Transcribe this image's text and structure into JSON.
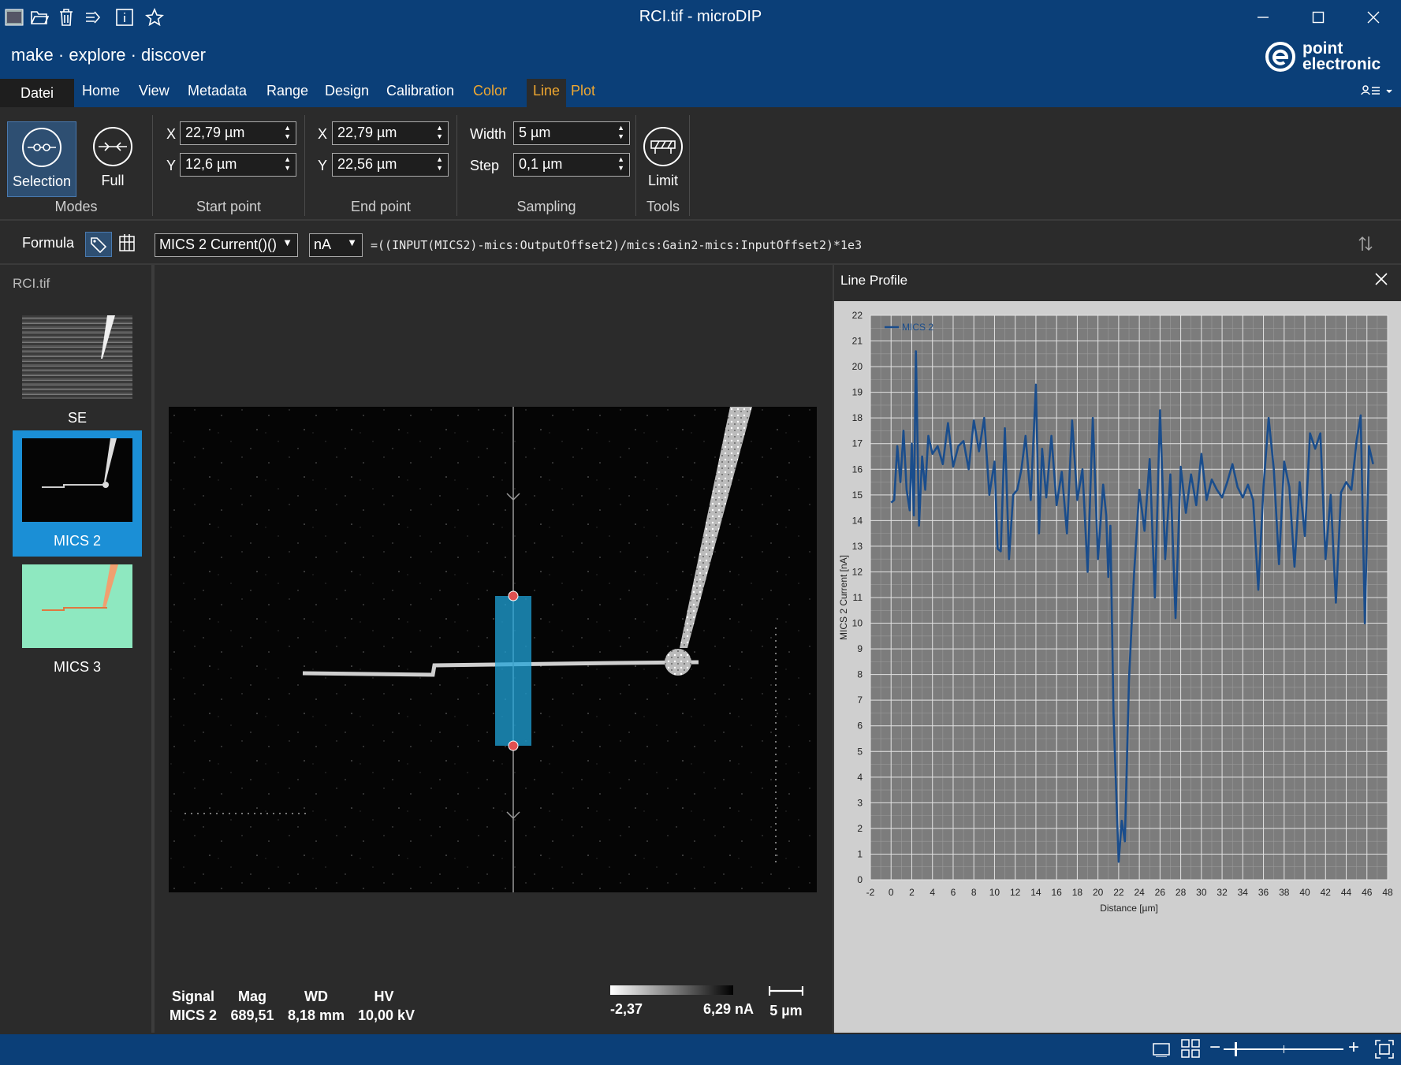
{
  "window": {
    "title": "RCI.tif - microDIP"
  },
  "header": {
    "slogan": "make · explore · discover",
    "brand": {
      "line1": "point",
      "line2": "electronic"
    }
  },
  "menu": {
    "file": "Datei",
    "items": [
      "Home",
      "View",
      "Metadata",
      "Range",
      "Design",
      "Calibration",
      "Color",
      "Line",
      "Plot"
    ]
  },
  "colors": {
    "accent": "#0b3f78",
    "contextual_tab": "#f0a830",
    "plot_line": "#1a4d8c",
    "selection": "#1fa3d8",
    "handle": "#e05050"
  },
  "ribbon": {
    "modes": {
      "selection": "Selection",
      "full": "Full",
      "label": "Modes"
    },
    "start": {
      "x_label": "X",
      "x": "22,79 µm",
      "y_label": "Y",
      "y": "12,6 µm",
      "label": "Start point"
    },
    "end": {
      "x_label": "X",
      "x": "22,79 µm",
      "y_label": "Y",
      "y": "22,56 µm",
      "label": "End point"
    },
    "sampling": {
      "width_label": "Width",
      "width": "5 µm",
      "step_label": "Step",
      "step": "0,1 µm",
      "label": "Sampling"
    },
    "tools": {
      "limit": "Limit",
      "label": "Tools"
    }
  },
  "formula": {
    "label": "Formula",
    "signal": "MICS 2 Current()()",
    "unit": "nA",
    "expression": "=((INPUT(MICS2)-mics:OutputOffset2)/mics:Gain2-mics:InputOffset2)*1e3"
  },
  "files": {
    "name": "RCI.tif",
    "thumbs": [
      "SE",
      "MICS 2",
      "MICS 3"
    ],
    "selected": "MICS 2"
  },
  "scaninfo": {
    "signal_h": "Signal",
    "signal": "MICS 2",
    "mag_h": "Mag",
    "mag": "689,51",
    "wd_h": "WD",
    "wd": "8,18 mm",
    "hv_h": "HV",
    "hv": "10,00 kV",
    "scale_min": "-2,37",
    "scale_max": "6,29 nA",
    "scalebar": "5 µm"
  },
  "panel": {
    "title": "Line Profile"
  },
  "chart_data": {
    "type": "line",
    "xlabel": "Distance [µm]",
    "ylabel": "MICS 2 Current [nA]",
    "xlim": [
      -2,
      48
    ],
    "ylim": [
      0,
      22
    ],
    "xticks": [
      -2,
      0,
      2,
      4,
      6,
      8,
      10,
      12,
      14,
      16,
      18,
      20,
      22,
      24,
      26,
      28,
      30,
      32,
      34,
      36,
      38,
      40,
      42,
      44,
      46,
      48
    ],
    "yticks": [
      0,
      1,
      2,
      3,
      4,
      5,
      6,
      7,
      8,
      9,
      10,
      11,
      12,
      13,
      14,
      15,
      16,
      17,
      18,
      19,
      20,
      21,
      22
    ],
    "grid": true,
    "legend": "top-left",
    "series": [
      {
        "name": "MICS 2",
        "x": [
          0,
          0.3,
          0.6,
          0.9,
          1.2,
          1.5,
          1.8,
          2.0,
          2.2,
          2.4,
          2.7,
          3.0,
          3.3,
          3.6,
          4.0,
          4.5,
          5.0,
          5.5,
          6.0,
          6.5,
          7.0,
          7.5,
          8.0,
          8.5,
          9.0,
          9.5,
          10.0,
          10.3,
          10.6,
          11.0,
          11.4,
          11.8,
          12.2,
          12.6,
          13.0,
          13.5,
          14.0,
          14.3,
          14.6,
          15.0,
          15.5,
          16.0,
          16.5,
          17.0,
          17.5,
          18.0,
          18.5,
          19.0,
          19.5,
          20.0,
          20.5,
          20.8,
          21.0,
          21.2,
          21.5,
          21.8,
          22.0,
          22.3,
          22.6,
          23.0,
          23.5,
          24.0,
          24.5,
          25.0,
          25.5,
          26.0,
          26.5,
          27.0,
          27.5,
          28.0,
          28.5,
          29.0,
          29.5,
          30.0,
          30.5,
          31.0,
          31.5,
          32.0,
          32.5,
          33.0,
          33.5,
          34.0,
          34.5,
          35.0,
          35.5,
          36.0,
          36.5,
          37.0,
          37.5,
          38.0,
          38.5,
          39.0,
          39.5,
          40.0,
          40.5,
          41.0,
          41.5,
          42.0,
          42.5,
          43.0,
          43.5,
          44.0,
          44.5,
          45.0,
          45.4,
          45.8,
          46.2,
          46.6
        ],
        "values": [
          14.7,
          14.8,
          16.9,
          15.5,
          17.5,
          15.2,
          14.4,
          17.0,
          14.2,
          20.6,
          13.8,
          16.5,
          15.2,
          17.3,
          16.6,
          16.9,
          16.2,
          17.8,
          16.1,
          16.9,
          17.1,
          16.0,
          17.9,
          16.7,
          18.0,
          15.0,
          16.3,
          12.9,
          12.8,
          17.6,
          12.5,
          15.0,
          15.2,
          16.0,
          17.3,
          14.8,
          19.3,
          13.5,
          16.8,
          14.9,
          17.3,
          14.6,
          15.9,
          13.5,
          17.9,
          14.8,
          16.0,
          12.0,
          18.0,
          12.5,
          15.4,
          14.2,
          11.8,
          13.8,
          6.5,
          3.0,
          0.7,
          2.3,
          1.5,
          7.8,
          12.0,
          15.2,
          13.6,
          16.4,
          11.0,
          18.3,
          12.5,
          15.8,
          10.2,
          16.1,
          14.3,
          15.8,
          14.6,
          16.6,
          14.8,
          15.6,
          15.2,
          14.9,
          15.5,
          16.2,
          15.3,
          14.9,
          15.4,
          14.8,
          11.3,
          15.3,
          18.0,
          16.0,
          12.3,
          16.3,
          15.3,
          12.2,
          15.5,
          13.4,
          17.4,
          16.8,
          17.4,
          12.5,
          15.0,
          10.8,
          15.1,
          15.5,
          15.2,
          17.1,
          18.1,
          10.0,
          16.9,
          16.2
        ]
      }
    ]
  },
  "status": {
    "zoom_minus": "−",
    "zoom_plus": "+"
  }
}
